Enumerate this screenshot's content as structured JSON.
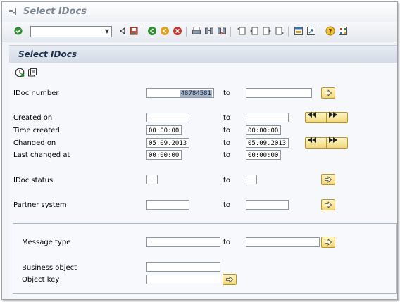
{
  "window": {
    "title": "Select IDocs"
  },
  "toolbar": {
    "command_value": "",
    "icons": [
      "enter-icon",
      "back-icon",
      "save-icon",
      "back-nav-icon",
      "exit-icon",
      "cancel-icon",
      "print-icon",
      "find-icon",
      "find-next-icon",
      "first-page-icon",
      "prev-page-icon",
      "next-page-icon",
      "last-page-icon",
      "new-session-icon",
      "shortcut-icon",
      "help-icon",
      "layout-icon"
    ]
  },
  "page": {
    "title": "Select IDocs",
    "app_toolbar": [
      "execute-icon",
      "get-variant-icon"
    ]
  },
  "to_label": "to",
  "fields": {
    "idoc_number": {
      "label": "IDoc number",
      "from": "48784581",
      "to": ""
    },
    "created_on": {
      "label": "Created on",
      "from": "",
      "to": ""
    },
    "time_created": {
      "label": "Time created",
      "from": "00:00:00",
      "to": "00:00:00"
    },
    "changed_on": {
      "label": "Changed on",
      "from": "05.09.2013",
      "to": "05.09.2013"
    },
    "last_changed_at": {
      "label": "Last changed at",
      "from": "00:00:00",
      "to": "00:00:00"
    },
    "idoc_status": {
      "label": "IDoc status",
      "from": "",
      "to": ""
    },
    "partner_system": {
      "label": "Partner system",
      "from": "",
      "to": ""
    }
  },
  "group": {
    "message_type": {
      "label": "Message type",
      "from": "",
      "to": ""
    },
    "business_object": {
      "label": "Business object",
      "value": ""
    },
    "object_key": {
      "label": "Object key",
      "value": ""
    }
  },
  "colors": {
    "button_fill": "#f1d77a",
    "header_bg": "#d4dbe6",
    "accent_green": "#2e8b2e",
    "accent_red": "#c0392b"
  }
}
